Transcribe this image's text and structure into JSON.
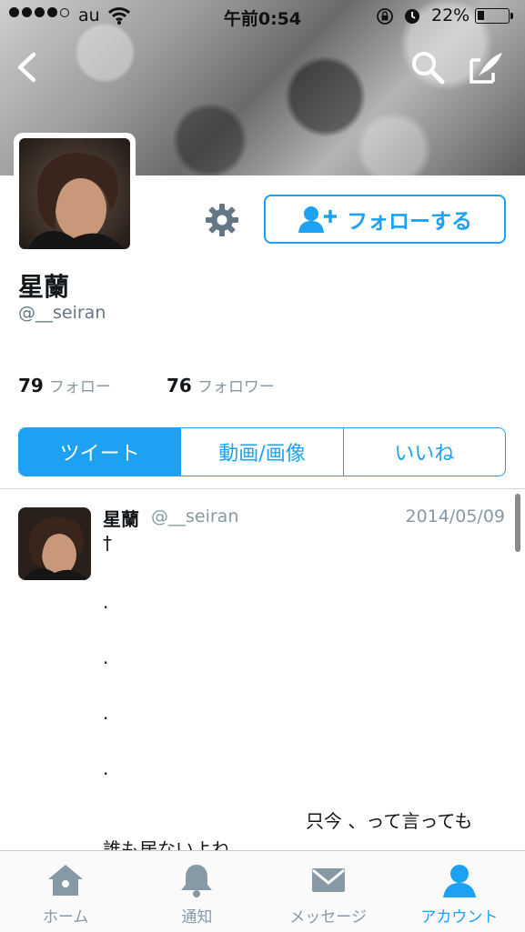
{
  "status_bar": {
    "carrier": "au",
    "time": "午前0:54",
    "battery_percent": "22%",
    "battery_level": 0.22
  },
  "profile": {
    "name": "星蘭",
    "handle": "@__seiran",
    "follow_label": "フォローする",
    "following_count": "79",
    "following_label": "フォロー",
    "followers_count": "76",
    "followers_label": "フォロワー"
  },
  "segments": {
    "tweets": "ツイート",
    "media": "動画/画像",
    "likes": "いいね",
    "selected": "tweets"
  },
  "tweet": {
    "name": "星蘭",
    "handle": "@__seiran",
    "date": "2014/05/09",
    "lines": [
      "†",
      ".",
      ".",
      ".",
      ".",
      "只今 、って言っても",
      "誰も居ないよね"
    ]
  },
  "tabbar": {
    "home": "ホーム",
    "notifications": "通知",
    "messages": "メッセージ",
    "account": "アカウント",
    "active": "account"
  },
  "colors": {
    "accent": "#1da1f2",
    "inactive": "#8899a6"
  },
  "icons": [
    "back-icon",
    "search-icon",
    "compose-icon",
    "gear-icon",
    "follow-icon",
    "home-icon",
    "bell-icon",
    "envelope-icon",
    "person-icon"
  ]
}
